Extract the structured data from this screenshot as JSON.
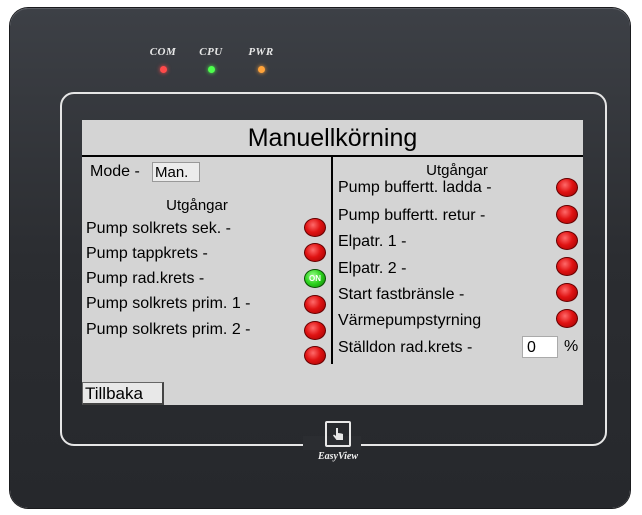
{
  "device": {
    "led_labels": [
      "COM",
      "CPU",
      "PWR"
    ],
    "led_colors": [
      "#ff4a4a",
      "#4dff4d",
      "#ffa33a"
    ],
    "brand": "EasyView"
  },
  "screen": {
    "title": "Manuellkörning",
    "mode_label": "Mode -",
    "mode_value": "Man.",
    "left_header": "Utgångar",
    "left_items": [
      {
        "label": "Pump solkrets sek. -",
        "state": "off"
      },
      {
        "label": "Pump tappkrets -",
        "state": "off"
      },
      {
        "label": "Pump rad.krets -",
        "state": "on"
      },
      {
        "label": "Pump solkrets prim. 1 -",
        "state": "off"
      },
      {
        "label": "Pump solkrets prim. 2 -",
        "state": "off"
      },
      {
        "label": "",
        "state": "off"
      }
    ],
    "on_text": "ON",
    "right_header": "Utgångar",
    "right_items": [
      {
        "label": "Pump buffertt. ladda -",
        "state": "off"
      },
      {
        "label": "Pump buffertt. retur -",
        "state": "off"
      },
      {
        "label": "Elpatr. 1 -",
        "state": "off"
      },
      {
        "label": "Elpatr. 2 -",
        "state": "off"
      },
      {
        "label": "Start fastbränsle -",
        "state": "off"
      },
      {
        "label": "Värmepumpstyrning",
        "state": "off"
      }
    ],
    "valve_label": "Ställdon rad.krets -",
    "valve_value": "0",
    "valve_unit": "%",
    "back_button": "Tillbaka"
  }
}
